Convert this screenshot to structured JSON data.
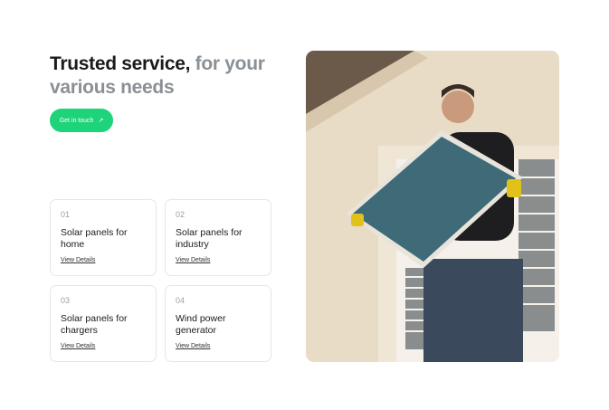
{
  "hero": {
    "title_dark": "Trusted service,",
    "title_muted": " for your various needs",
    "cta_label": "Get in touch",
    "cta_icon": "arrow-up-right-icon"
  },
  "cards": [
    {
      "number": "01",
      "title": "Solar panels for home",
      "link": "View Details"
    },
    {
      "number": "02",
      "title": "Solar panels for industry",
      "link": "View Details"
    },
    {
      "number": "03",
      "title": "Solar panels for chargers",
      "link": "View Details"
    },
    {
      "number": "04",
      "title": "Wind power generator",
      "link": "View Details"
    }
  ],
  "colors": {
    "accent": "#1ed47a"
  }
}
